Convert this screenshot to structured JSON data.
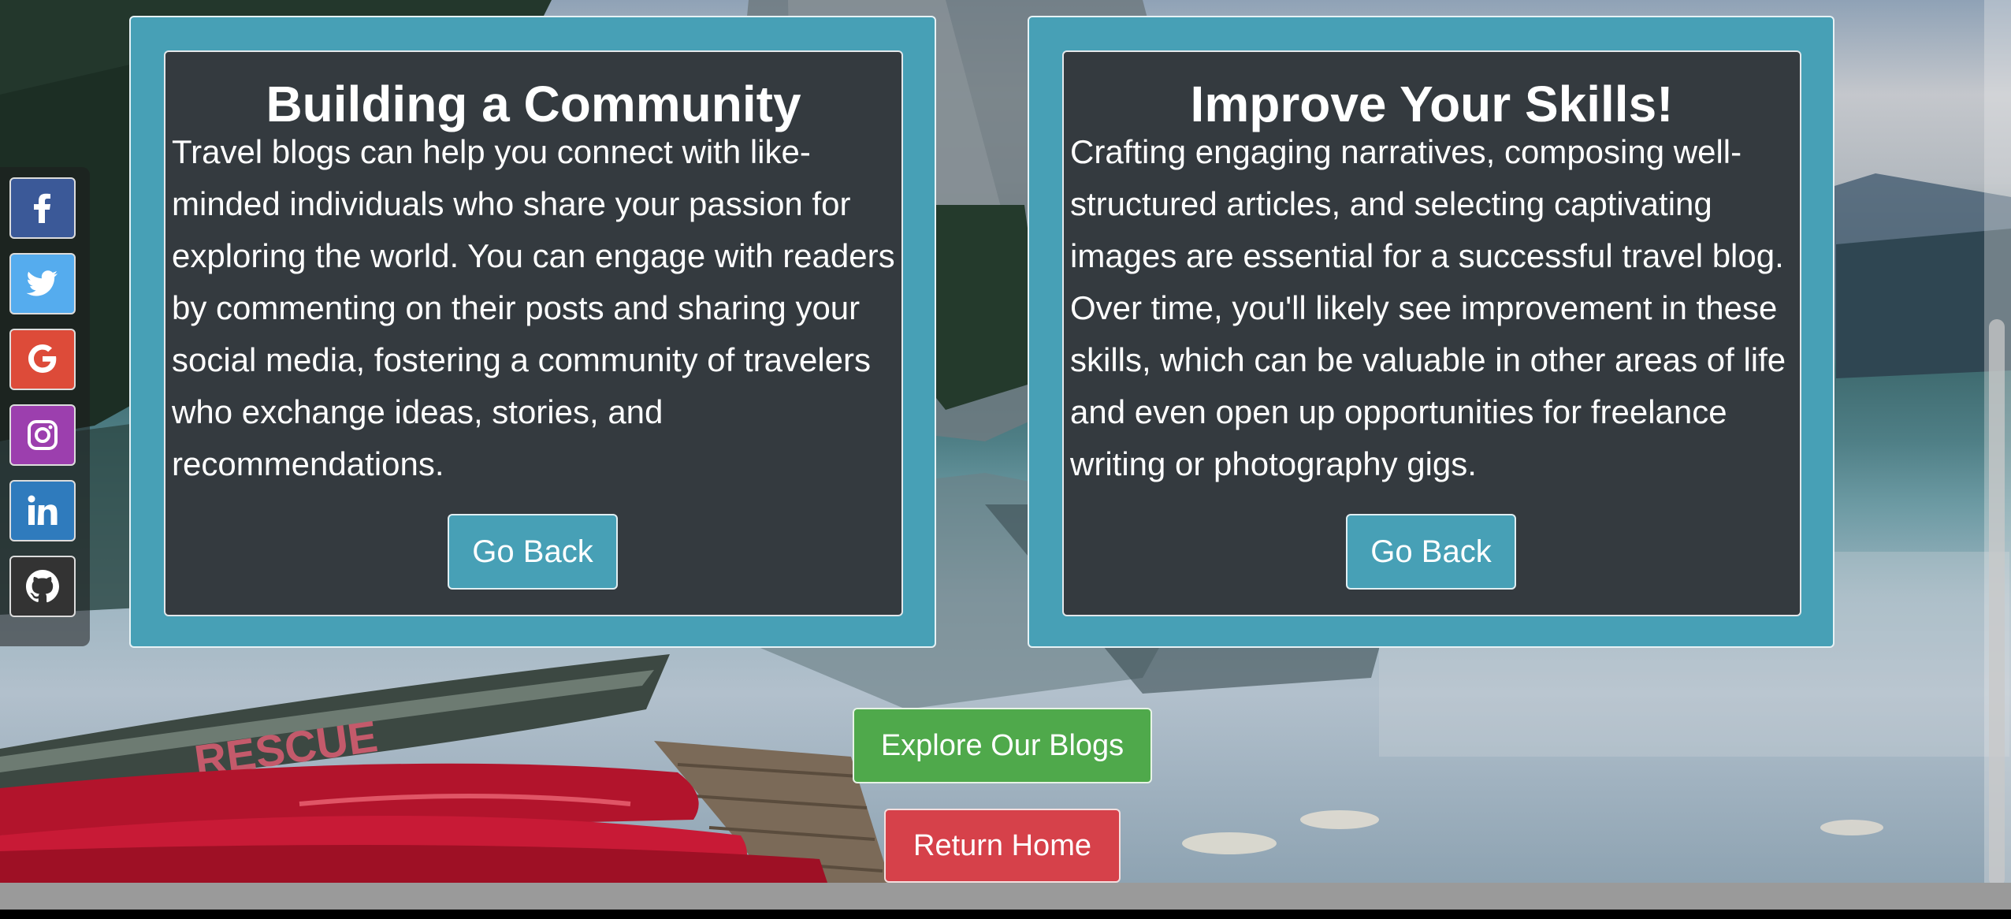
{
  "cards": [
    {
      "title": "Building a Community",
      "text": "Travel blogs can help you connect with like-minded individuals who share your passion for exploring the world. You can engage with readers by commenting on their posts and sharing your social media, fostering a community of travelers who exchange ideas, stories, and recommendations.",
      "button_label": "Go Back"
    },
    {
      "title": "Improve Your Skills!",
      "text": "Crafting engaging narratives, composing well-structured articles, and selecting captivating images are essential for a successful travel blog. Over time, you'll likely see improvement in these skills, which can be valuable in other areas of life and even open up opportunities for freelance writing or photography gigs.",
      "button_label": "Go Back"
    }
  ],
  "actions": {
    "explore_label": "Explore Our Blogs",
    "home_label": "Return Home"
  },
  "social": [
    {
      "name": "facebook-icon",
      "color": "#3b5998"
    },
    {
      "name": "twitter-icon",
      "color": "#55acee"
    },
    {
      "name": "google-icon",
      "color": "#dd4b39"
    },
    {
      "name": "instagram-icon",
      "color": "#9c3fae"
    },
    {
      "name": "linkedin-icon",
      "color": "#2f7bbd"
    },
    {
      "name": "github-icon",
      "color": "#333333"
    }
  ],
  "background": {
    "rescue_text": "RESCUE"
  },
  "colors": {
    "card_outer": "#47a0b6",
    "card_inner": "#343a3f",
    "explore": "#4fa94b",
    "home": "#d6414a"
  }
}
